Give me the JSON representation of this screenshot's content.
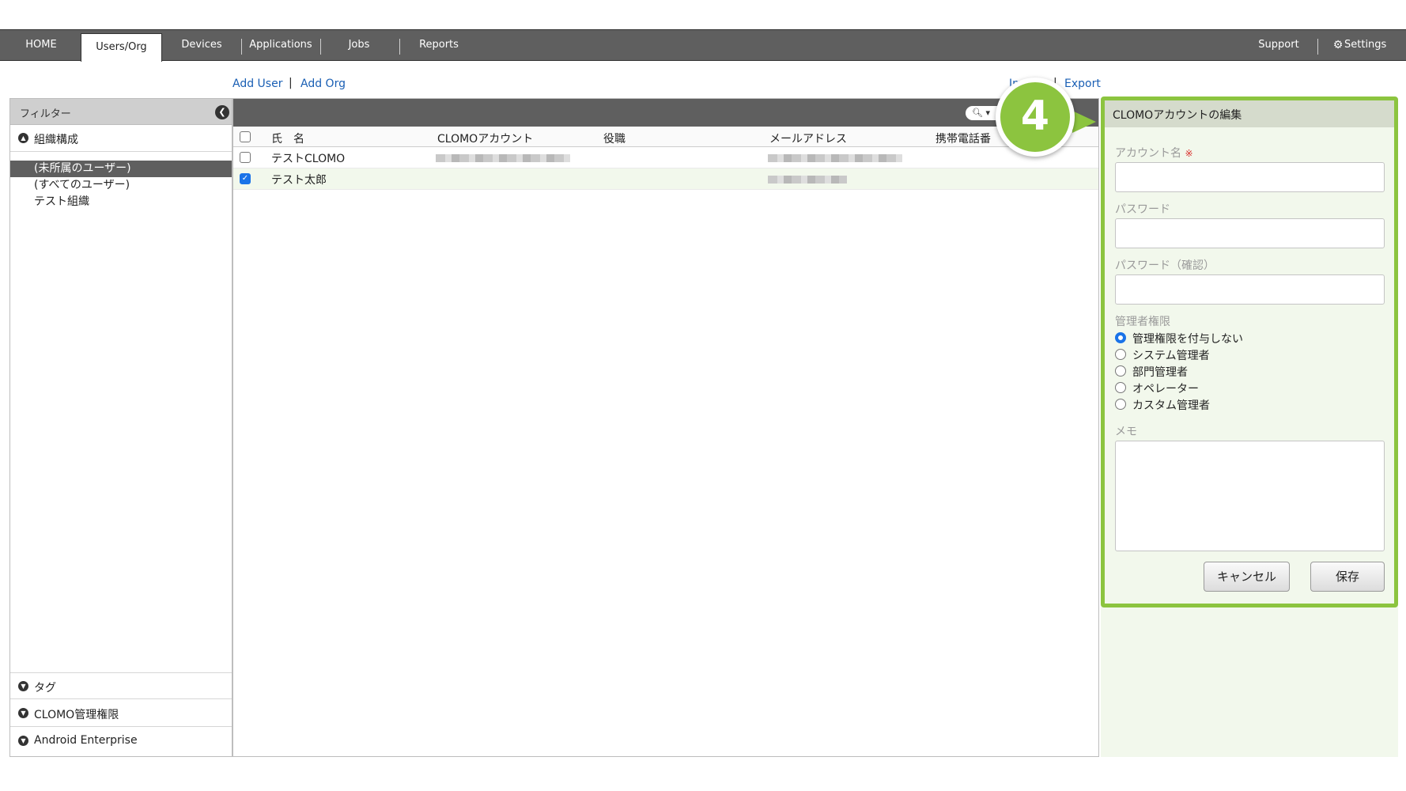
{
  "nav": {
    "tabs": [
      {
        "label": "HOME"
      },
      {
        "label": "Users/Org"
      },
      {
        "label": "Devices"
      },
      {
        "label": "Applications"
      },
      {
        "label": "Jobs"
      },
      {
        "label": "Reports"
      }
    ],
    "right": {
      "support": "Support",
      "settings": "Settings"
    }
  },
  "actions": {
    "add_user": "Add User",
    "add_org": "Add Org",
    "import": "Im",
    "export": "Export"
  },
  "sidebar": {
    "header": "フィルター",
    "org_section": "組織構成",
    "tree": [
      "(未所属のユーザー)",
      "(すべてのユーザー)",
      "テスト組織"
    ],
    "bottom_sections": [
      "タグ",
      "CLOMO管理権限",
      "Android Enterprise"
    ]
  },
  "table": {
    "columns": [
      "氏　名",
      "CLOMOアカウント",
      "役職",
      "メールアドレス",
      "携帯電話番"
    ],
    "rows": [
      {
        "name": "テストCLOMO",
        "checked": false
      },
      {
        "name": "テスト太郎",
        "checked": true
      }
    ]
  },
  "panel": {
    "title": "CLOMOアカウントの編集",
    "account_label": "アカウント名",
    "required_mark": "※",
    "password_label": "パスワード",
    "password_confirm_label": "パスワード（確認）",
    "role_label": "管理者権限",
    "roles": [
      "管理権限を付与しない",
      "システム管理者",
      "部門管理者",
      "オペレーター",
      "カスタム管理者"
    ],
    "selected_role": 0,
    "memo_label": "メモ",
    "cancel": "キャンセル",
    "save": "保存"
  },
  "callout": {
    "number": "4",
    "color": "#8cc43f"
  }
}
